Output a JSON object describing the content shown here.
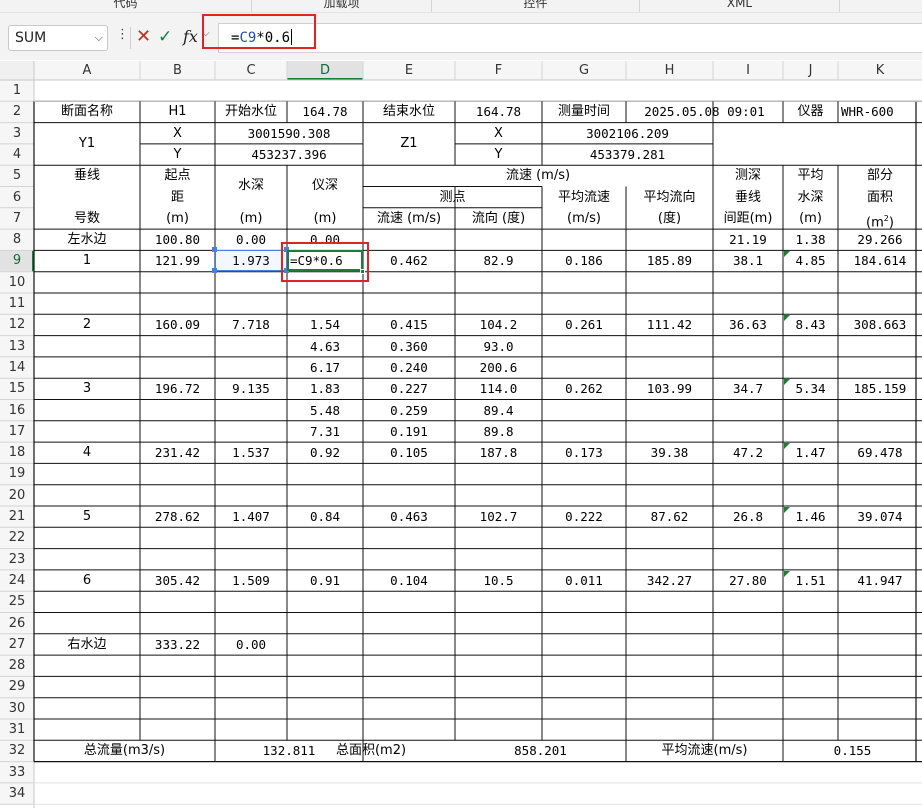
{
  "ribbon": {
    "groups": [
      "代码",
      "加载项",
      "控件",
      "XML"
    ]
  },
  "formula_bar": {
    "name_box": "SUM",
    "more_icon": "⋮",
    "cancel_icon": "✕",
    "enter_icon": "✓",
    "fx_label": "fx",
    "formula_eq": "=",
    "formula_ref": "C9",
    "formula_rest": "*0.6"
  },
  "columns": [
    "A",
    "B",
    "C",
    "D",
    "E",
    "F",
    "G",
    "H",
    "I",
    "J",
    "K"
  ],
  "rows": [
    "1",
    "2",
    "3",
    "4",
    "5",
    "6",
    "7",
    "8",
    "9",
    "10",
    "11",
    "12",
    "13",
    "14",
    "15",
    "16",
    "17",
    "18",
    "19",
    "20",
    "21",
    "22",
    "23",
    "24",
    "25",
    "26",
    "27",
    "28",
    "29",
    "30",
    "31",
    "32",
    "33",
    "34"
  ],
  "active": {
    "column": "D",
    "row": "9"
  },
  "colors": {
    "accent_green": "#1e7b3a",
    "highlight_red": "#e02424",
    "selection_blue": "#4a7fd8",
    "formula_ref_blue": "#1f4ea8"
  },
  "header": {
    "section_name_label": "断面名称",
    "section_name": "H1",
    "start_level_label": "开始水位",
    "start_level": "164.78",
    "end_level_label": "结束水位",
    "end_level": "164.78",
    "measure_time_label": "测量时间",
    "measure_time": "2025.05.08 09:01",
    "instrument_label": "仪器",
    "instrument": "WHR-600",
    "y1_label": "Y1",
    "y1_x_label": "X",
    "y1_x": "3001590.308",
    "y1_y_label": "Y",
    "y1_y": "453237.396",
    "z1_label": "Z1",
    "z1_x_label": "X",
    "z1_x": "3002106.209",
    "z1_y_label": "Y",
    "z1_y": "453379.281"
  },
  "col_headers": {
    "vertical_line": "垂线",
    "vertical_no": "号数",
    "start_dist_1": "起点",
    "start_dist_2": "距",
    "start_dist_unit": "(m)",
    "depth": "水深",
    "depth_unit": "(m)",
    "inst_depth": "仪深",
    "inst_depth_unit": "(m)",
    "velocity": "流速 (m/s)",
    "measure_point": "测点",
    "point_speed": "流速 (m/s)",
    "point_dir": "流向 (度)",
    "avg_speed": "平均流速",
    "avg_speed_unit": "(m/s)",
    "avg_dir": "平均流向",
    "avg_dir_unit": "(度)",
    "sounding_1": "测深",
    "sounding_2": "垂线",
    "sounding_3": "间距(m)",
    "avg_depth_1": "平均",
    "avg_depth_2": "水深",
    "avg_depth_unit": "(m)",
    "part_area_1": "部分",
    "part_area_2": "面积",
    "part_area_unit": "(m",
    "part_area_sup": "2",
    "part_area_close": ")"
  },
  "data_rows": [
    {
      "row": "8",
      "a": "左水边",
      "b": "100.80",
      "c": "0.00",
      "d": "0.00",
      "e": "",
      "f": "",
      "g": "",
      "h": "",
      "i": "21.19",
      "j": "1.38",
      "k": "29.266"
    },
    {
      "row": "9",
      "a": "1",
      "b": "121.99",
      "c": "1.973",
      "d": "=C9*0.6",
      "e": "0.462",
      "f": "82.9",
      "g": "0.186",
      "h": "185.89",
      "i": "38.1",
      "j": "4.85",
      "k": "184.614"
    },
    {
      "row": "12",
      "a": "2",
      "b": "160.09",
      "c": "7.718",
      "d": "1.54",
      "e": "0.415",
      "f": "104.2",
      "g": "0.261",
      "h": "111.42",
      "i": "36.63",
      "j": "8.43",
      "k": "308.663"
    },
    {
      "row": "13",
      "a": "",
      "b": "",
      "c": "",
      "d": "4.63",
      "e": "0.360",
      "f": "93.0",
      "g": "",
      "h": "",
      "i": "",
      "j": "",
      "k": ""
    },
    {
      "row": "14",
      "a": "",
      "b": "",
      "c": "",
      "d": "6.17",
      "e": "0.240",
      "f": "200.6",
      "g": "",
      "h": "",
      "i": "",
      "j": "",
      "k": ""
    },
    {
      "row": "15",
      "a": "3",
      "b": "196.72",
      "c": "9.135",
      "d": "1.83",
      "e": "0.227",
      "f": "114.0",
      "g": "0.262",
      "h": "103.99",
      "i": "34.7",
      "j": "5.34",
      "k": "185.159"
    },
    {
      "row": "16",
      "a": "",
      "b": "",
      "c": "",
      "d": "5.48",
      "e": "0.259",
      "f": "89.4",
      "g": "",
      "h": "",
      "i": "",
      "j": "",
      "k": ""
    },
    {
      "row": "17",
      "a": "",
      "b": "",
      "c": "",
      "d": "7.31",
      "e": "0.191",
      "f": "89.8",
      "g": "",
      "h": "",
      "i": "",
      "j": "",
      "k": ""
    },
    {
      "row": "18",
      "a": "4",
      "b": "231.42",
      "c": "1.537",
      "d": "0.92",
      "e": "0.105",
      "f": "187.8",
      "g": "0.173",
      "h": "39.38",
      "i": "47.2",
      "j": "1.47",
      "k": "69.478"
    },
    {
      "row": "21",
      "a": "5",
      "b": "278.62",
      "c": "1.407",
      "d": "0.84",
      "e": "0.463",
      "f": "102.7",
      "g": "0.222",
      "h": "87.62",
      "i": "26.8",
      "j": "1.46",
      "k": "39.074"
    },
    {
      "row": "24",
      "a": "6",
      "b": "305.42",
      "c": "1.509",
      "d": "0.91",
      "e": "0.104",
      "f": "10.5",
      "g": "0.011",
      "h": "342.27",
      "i": "27.80",
      "j": "1.51",
      "k": "41.947"
    },
    {
      "row": "27",
      "a": "右水边",
      "b": "333.22",
      "c": "0.00",
      "d": "",
      "e": "",
      "f": "",
      "g": "",
      "h": "",
      "i": "",
      "j": "",
      "k": ""
    }
  ],
  "summary": {
    "total_flow_label": "总流量(m3/s)",
    "total_flow": "132.811",
    "total_area_label": "总面积(m2)",
    "total_area": "858.201",
    "avg_speed_label": "平均流速(m/s)",
    "avg_speed": "0.155"
  }
}
